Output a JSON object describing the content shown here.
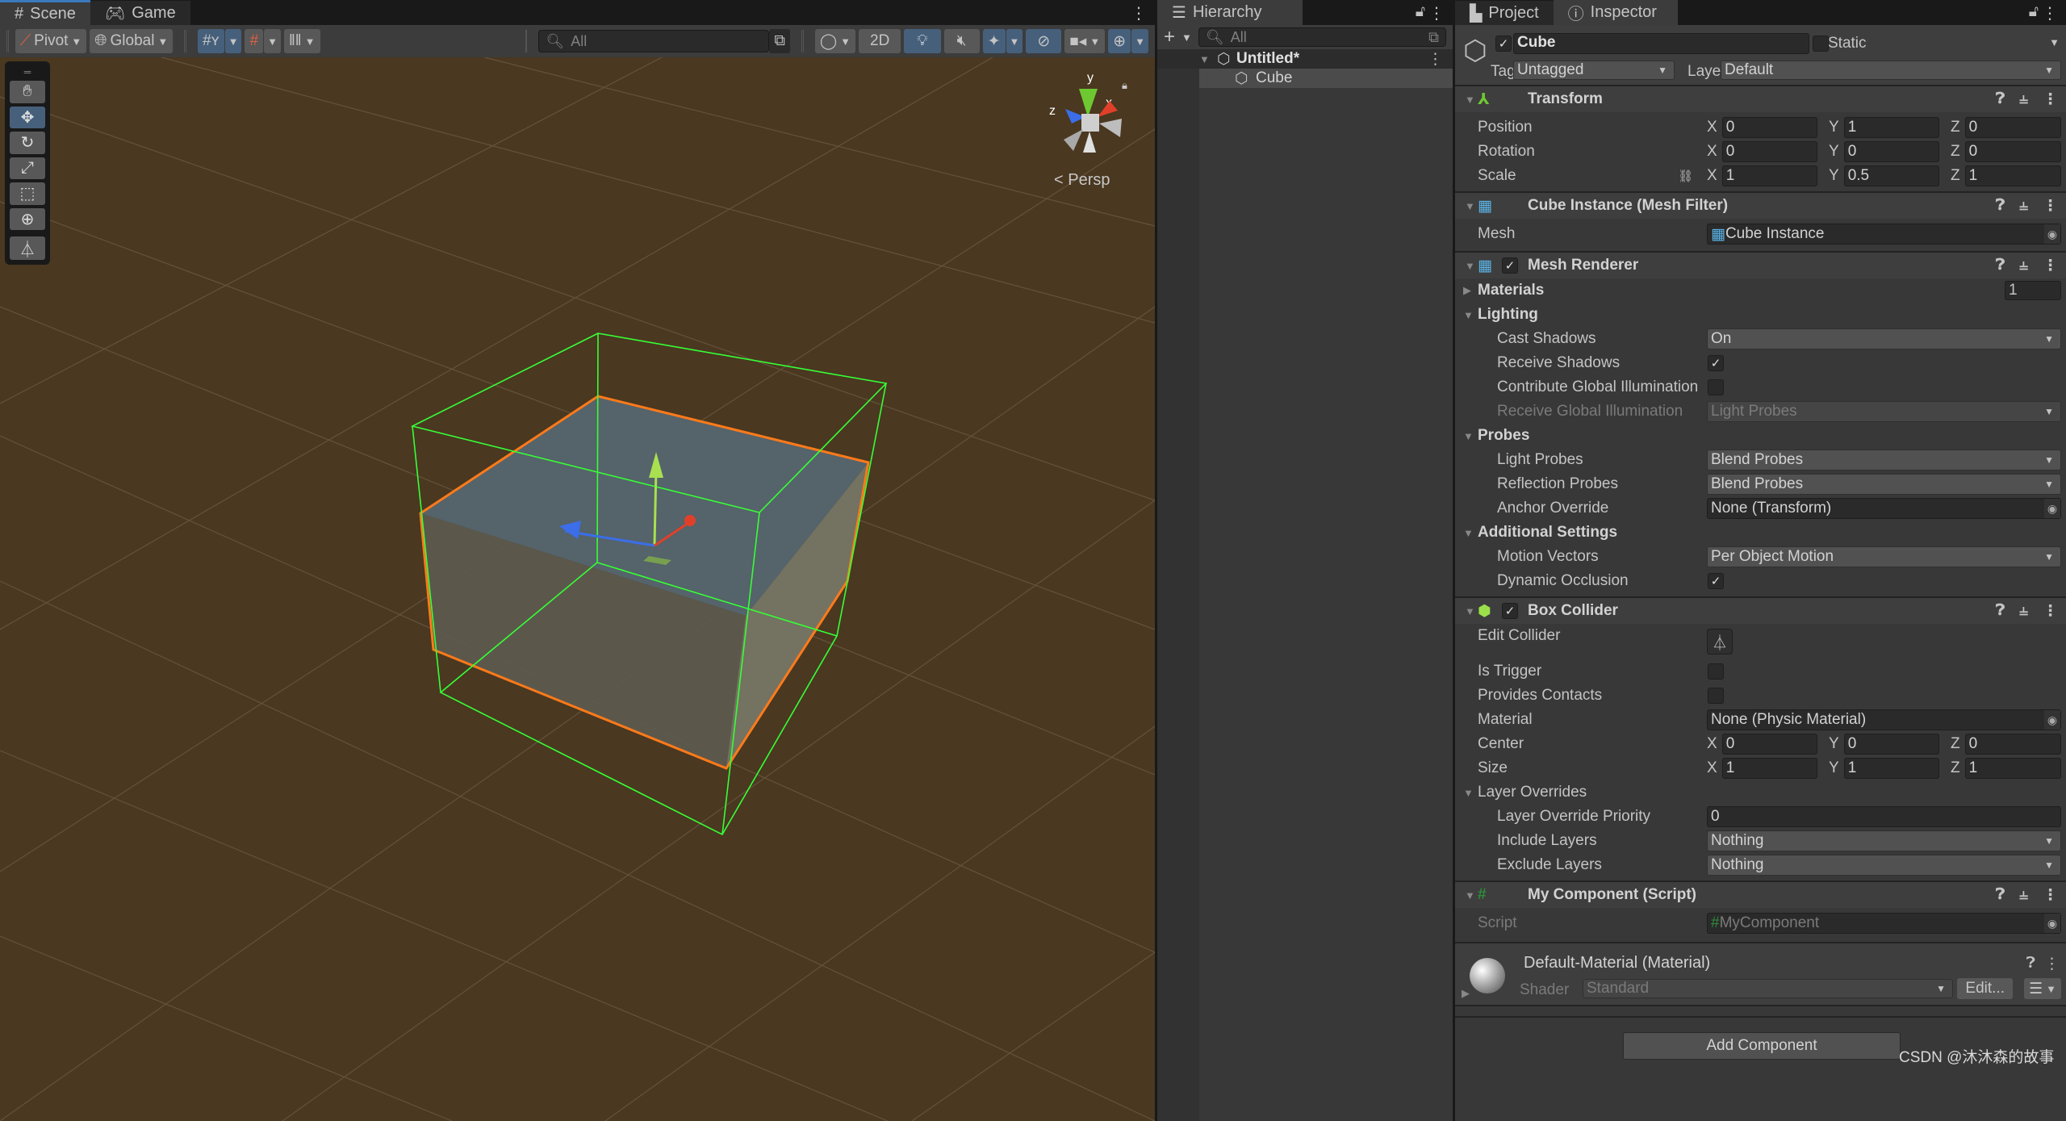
{
  "scene_panel": {
    "tabs": [
      {
        "label": "Scene",
        "icon": "grid-hash-icon"
      },
      {
        "label": "Game",
        "icon": "gamepad-icon"
      }
    ],
    "toolbar": {
      "pivot_label": "Pivot",
      "global_label": "Global",
      "search_placeholder": "All",
      "twod_label": "2D"
    },
    "tools": [
      "hand-tool",
      "move-tool",
      "rotate-tool",
      "scale-tool",
      "rect-tool",
      "transform-tool",
      "custom-editor-tool"
    ],
    "active_tool": "move-tool",
    "gizmo": {
      "x": "x",
      "y": "y",
      "z": "z",
      "projection": "Persp"
    },
    "colors": {
      "background": "#4a3820",
      "selection_outline": "#ff7a1a",
      "collider_wire": "#36ff36",
      "axis_x": "#e0402a",
      "axis_y": "#a8e050",
      "axis_z": "#3b6ee8"
    }
  },
  "hierarchy": {
    "tab_label": "Hierarchy",
    "search_placeholder": "All",
    "scene_name": "Untitled*",
    "items": [
      {
        "label": "Cube"
      }
    ]
  },
  "inspector": {
    "tabs": [
      {
        "label": "Project"
      },
      {
        "label": "Inspector"
      }
    ],
    "object": {
      "active": true,
      "name": "Cube",
      "static_label": "Static",
      "static": false,
      "tag_label": "Tag",
      "tag": "Untagged",
      "layer_label": "Layer",
      "layer": "Default"
    },
    "transform": {
      "title": "Transform",
      "position": {
        "label": "Position",
        "x": "0",
        "y": "1",
        "z": "0"
      },
      "rotation": {
        "label": "Rotation",
        "x": "0",
        "y": "0",
        "z": "0"
      },
      "scale": {
        "label": "Scale",
        "x": "1",
        "y": "0.5",
        "z": "1"
      }
    },
    "mesh_filter": {
      "title": "Cube Instance (Mesh Filter)",
      "mesh_label": "Mesh",
      "mesh": "Cube Instance"
    },
    "mesh_renderer": {
      "title": "Mesh Renderer",
      "enabled": true,
      "materials_label": "Materials",
      "materials_count": "1",
      "lighting_label": "Lighting",
      "cast_shadows_label": "Cast Shadows",
      "cast_shadows": "On",
      "receive_shadows_label": "Receive Shadows",
      "receive_shadows": true,
      "contribute_gi_label": "Contribute Global Illumination",
      "contribute_gi": false,
      "receive_gi_label": "Receive Global Illumination",
      "receive_gi": "Light Probes",
      "probes_label": "Probes",
      "light_probes_label": "Light Probes",
      "light_probes": "Blend Probes",
      "reflection_probes_label": "Reflection Probes",
      "reflection_probes": "Blend Probes",
      "anchor_override_label": "Anchor Override",
      "anchor_override": "None (Transform)",
      "additional_label": "Additional Settings",
      "motion_vectors_label": "Motion Vectors",
      "motion_vectors": "Per Object Motion",
      "dynamic_occlusion_label": "Dynamic Occlusion",
      "dynamic_occlusion": true
    },
    "box_collider": {
      "title": "Box Collider",
      "enabled": true,
      "edit_collider_label": "Edit Collider",
      "is_trigger_label": "Is Trigger",
      "is_trigger": false,
      "provides_contacts_label": "Provides Contacts",
      "provides_contacts": false,
      "material_label": "Material",
      "material": "None (Physic Material)",
      "center": {
        "label": "Center",
        "x": "0",
        "y": "0",
        "z": "0"
      },
      "size": {
        "label": "Size",
        "x": "1",
        "y": "1",
        "z": "1"
      },
      "layer_overrides_label": "Layer Overrides",
      "priority_label": "Layer Override Priority",
      "priority": "0",
      "include_label": "Include Layers",
      "include": "Nothing",
      "exclude_label": "Exclude Layers",
      "exclude": "Nothing"
    },
    "my_component": {
      "title": "My Component (Script)",
      "script_label": "Script",
      "script": "MyComponent"
    },
    "material": {
      "title": "Default-Material (Material)",
      "shader_label": "Shader",
      "shader": "Standard",
      "edit_label": "Edit..."
    },
    "add_component_label": "Add Component"
  },
  "watermark": "CSDN @沐沐森的故事"
}
